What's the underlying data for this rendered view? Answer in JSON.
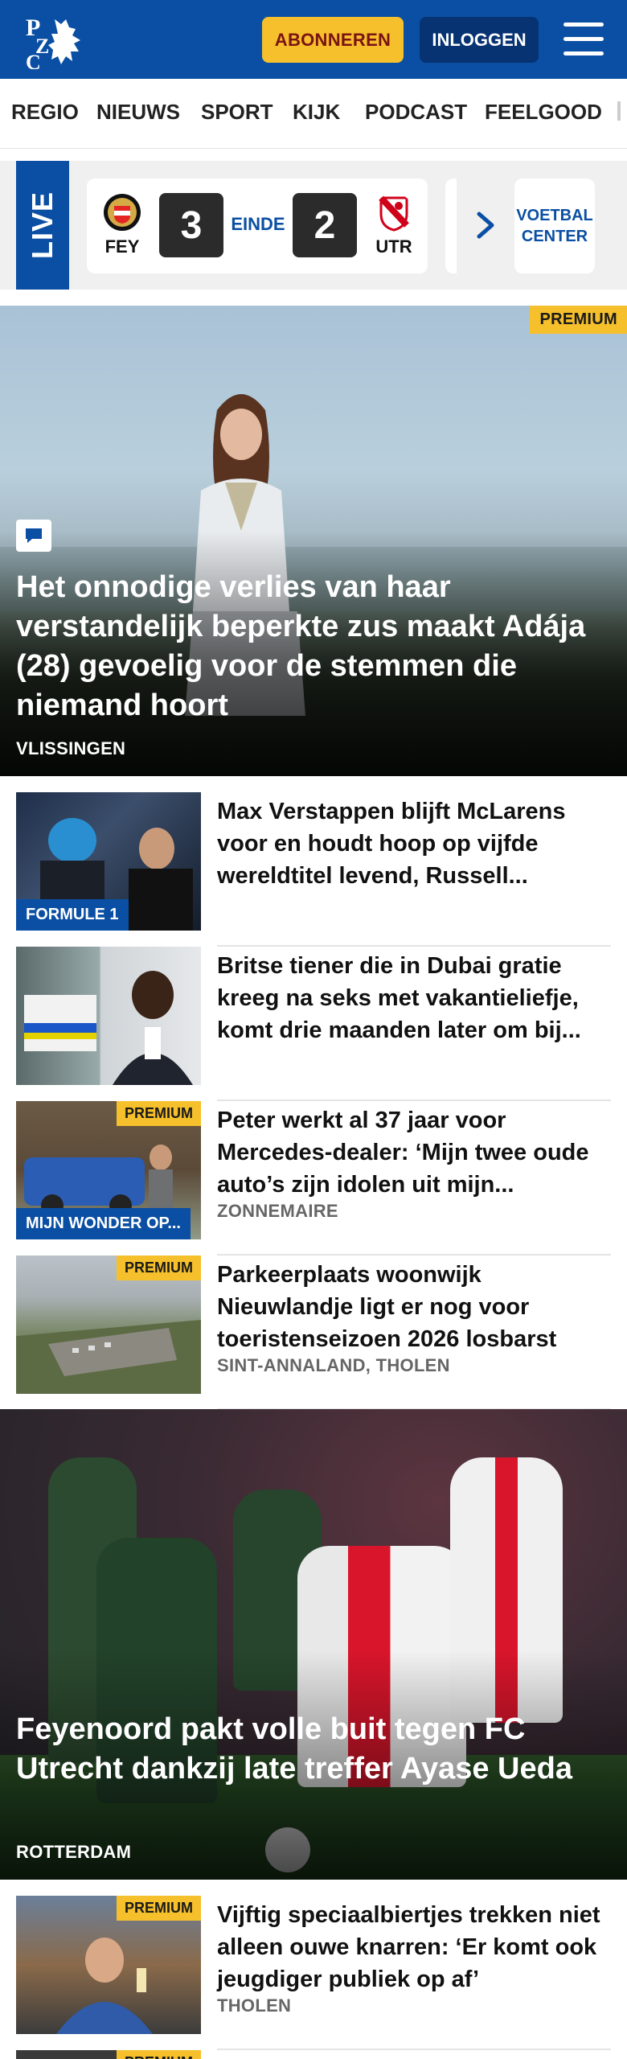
{
  "header": {
    "logo_text": "PZC",
    "subscribe_label": "ABONNEREN",
    "login_label": "INLOGGEN",
    "colors": {
      "brand": "#0a4fa3",
      "accent": "#f5c02b",
      "login_bg": "#073373"
    }
  },
  "nav": {
    "items": [
      "REGIO",
      "NIEUWS",
      "SPORT",
      "KIJK",
      "PODCAST",
      "FEELGOOD"
    ]
  },
  "live": {
    "label": "LIVE",
    "match": {
      "home": "FEY",
      "away": "UTR",
      "home_score": "3",
      "away_score": "2",
      "status": "EINDE"
    },
    "voetbal_center": "VOETBAL CENTER"
  },
  "hero": {
    "badge": "PREMIUM",
    "title": "Het onnodige verlies van haar verstandelijk beperkte zus maakt Adája (28) gevoelig voor de stemmen die niemand hoort",
    "location": "VLISSINGEN"
  },
  "articles": [
    {
      "title": "Max Verstappen blijft McLarens voor en houdt hoop op vijfde wereldtitel levend, Russell...",
      "category": "FORMULE 1",
      "premium": "",
      "location": ""
    },
    {
      "title": "Britse tiener die in Dubai gratie kreeg na seks met vakantieliefje, komt drie maanden later om bij...",
      "category": "",
      "premium": "",
      "location": ""
    },
    {
      "title": "Peter werkt al 37 jaar voor Mercedes-dealer: ‘Mijn twee oude auto’s zijn idolen uit mijn...",
      "category": "MIJN WONDER OP...",
      "premium": "PREMIUM",
      "location": "ZONNEMAIRE"
    },
    {
      "title": "Parkeerplaats woonwijk Nieuwlandje ligt er nog voor toeristenseizoen 2026 losbarst",
      "category": "",
      "premium": "PREMIUM",
      "location": "SINT-ANNALAND, THOLEN"
    }
  ],
  "hero2": {
    "title": "Feyenoord pakt volle buit tegen FC Utrecht dankzij late treffer Ayase Ueda",
    "location": "ROTTERDAM"
  },
  "article_after": {
    "title": "Vijftig speciaalbiertjes trekken niet alleen ouwe knarren: ‘Er komt ook jeugdiger publiek op af’",
    "premium": "PREMIUM",
    "location": "THOLEN"
  },
  "article_peek": {
    "premium": "PREMIUM"
  }
}
